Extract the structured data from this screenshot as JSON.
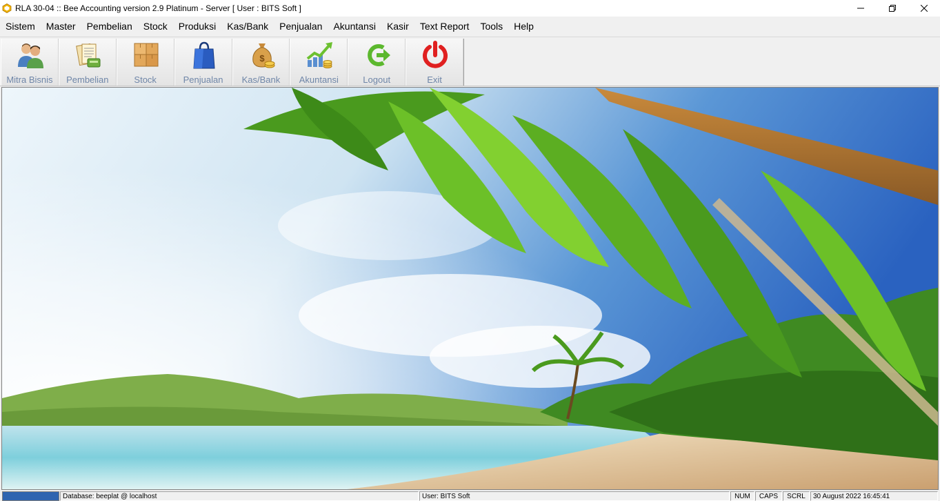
{
  "window": {
    "title": "RLA 30-04 :: Bee Accounting version 2.9 Platinum - Server  [ User : BITS Soft ]"
  },
  "menu": [
    {
      "label": "Sistem"
    },
    {
      "label": "Master"
    },
    {
      "label": "Pembelian"
    },
    {
      "label": "Stock"
    },
    {
      "label": "Produksi"
    },
    {
      "label": "Kas/Bank"
    },
    {
      "label": "Penjualan"
    },
    {
      "label": "Akuntansi"
    },
    {
      "label": "Kasir"
    },
    {
      "label": "Text Report"
    },
    {
      "label": "Tools"
    },
    {
      "label": "Help"
    }
  ],
  "toolbar": [
    {
      "label": "Mitra Bisnis",
      "icon": "business-partner-icon"
    },
    {
      "label": "Pembelian",
      "icon": "purchase-documents-icon"
    },
    {
      "label": "Stock",
      "icon": "stock-boxes-icon"
    },
    {
      "label": "Penjualan",
      "icon": "shopping-bag-icon"
    },
    {
      "label": "Kas/Bank",
      "icon": "money-bag-icon"
    },
    {
      "label": "Akuntansi",
      "icon": "growth-chart-icon"
    },
    {
      "label": "Logout",
      "icon": "logout-arrow-icon"
    },
    {
      "label": "Exit",
      "icon": "power-icon"
    }
  ],
  "status": {
    "database": "Database: beeplat @ localhost",
    "user": "User: BITS Soft",
    "num": "NUM",
    "caps": "CAPS",
    "scrl": "SCRL",
    "datetime": "30 August 2022  16:45:41"
  },
  "colors": {
    "toolbar_label": "#6f86a8",
    "progress": "#2f64b0",
    "exit_red": "#e02020",
    "logout_green": "#5cb82e"
  }
}
